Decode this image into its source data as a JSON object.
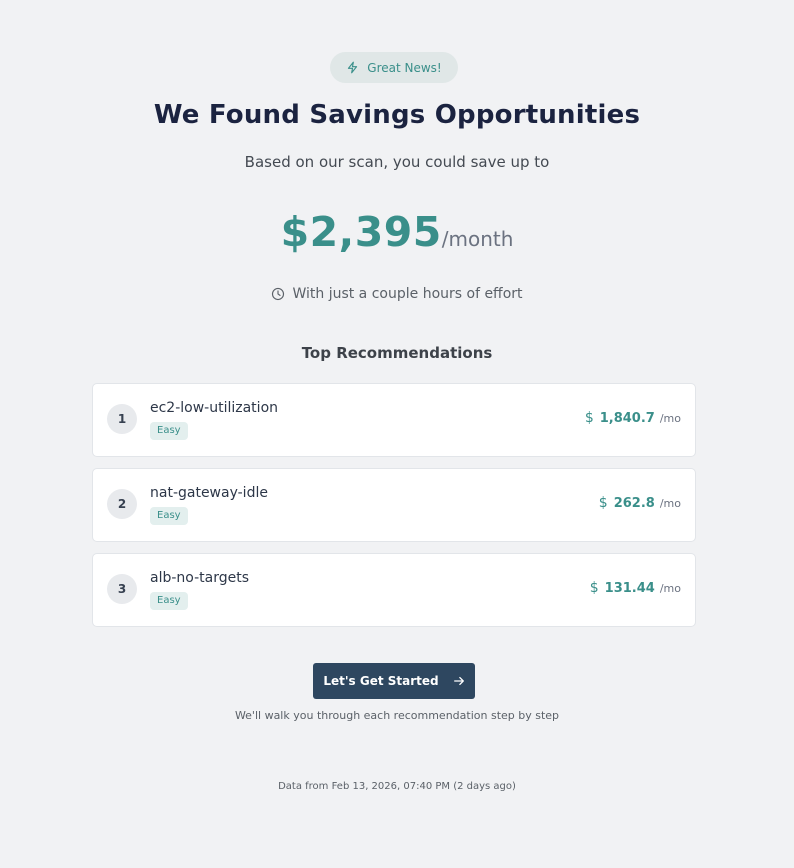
{
  "badge": {
    "label": "Great News!",
    "icon": "lightning-icon"
  },
  "hero": {
    "title": "We Found Savings Opportunities",
    "subtitle": "Based on our scan, you could save up to",
    "amount": "$2,395",
    "period": "/month",
    "effort": "With just a couple hours of effort"
  },
  "recommendations": {
    "title": "Top Recommendations",
    "items": [
      {
        "rank": "1",
        "name": "ec2-low-utilization",
        "difficulty": "Easy",
        "saving": "1,840.7",
        "unit": "/mo"
      },
      {
        "rank": "2",
        "name": "nat-gateway-idle",
        "difficulty": "Easy",
        "saving": "262.8",
        "unit": "/mo"
      },
      {
        "rank": "3",
        "name": "alb-no-targets",
        "difficulty": "Easy",
        "saving": "131.44",
        "unit": "/mo"
      }
    ]
  },
  "cta": {
    "label": "Let's Get Started",
    "hint": "We'll walk you through each recommendation step by step"
  },
  "footer": {
    "data_note": "Data from Feb 13, 2026, 07:40 PM (2 days ago)"
  },
  "colors": {
    "accent": "#3a8f8a",
    "title": "#1b2340",
    "button": "#2e4760",
    "background": "#f1f2f4"
  }
}
